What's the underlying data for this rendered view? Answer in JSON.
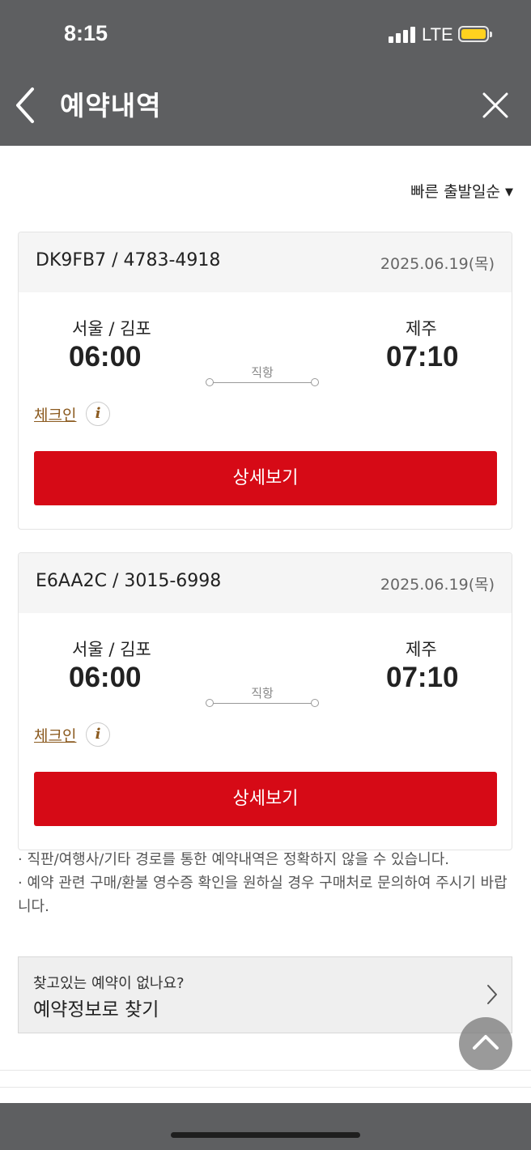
{
  "status_bar": {
    "time": "8:15",
    "network": "LTE",
    "icons": [
      "signal-icon",
      "battery-icon"
    ]
  },
  "header": {
    "title": "예약내역",
    "back_icon": "chevron-left-icon",
    "close_icon": "close-icon"
  },
  "sort": {
    "label": "빠른 출발일순",
    "caret": "▼"
  },
  "reservations": [
    {
      "code": "DK9FB7 / 4783-4918",
      "date": "2025.06.19(목)",
      "departure_city": "서울 / 김포",
      "departure_time": "06:00",
      "arrival_city": "제주",
      "arrival_time": "07:10",
      "route_type": "직항",
      "checkin_label": "체크인",
      "info_glyph": "i",
      "detail_label": "상세보기"
    },
    {
      "code": "E6AA2C / 3015-6998",
      "date": "2025.06.19(목)",
      "departure_city": "서울 / 김포",
      "departure_time": "06:00",
      "arrival_city": "제주",
      "arrival_time": "07:10",
      "route_type": "직항",
      "checkin_label": "체크인",
      "info_glyph": "i",
      "detail_label": "상세보기"
    }
  ],
  "notices": [
    "· 직판/여행사/기타 경로를 통한 예약내역은 정확하지 않을 수 있습니다.",
    "· 예약 관련 구매/환불 영수증 확인을 원하실 경우 구매처로 문의하여 주시기 바랍니다."
  ],
  "find": {
    "question": "찾고있는 예약이 없나요?",
    "link": "예약정보로 찾기"
  },
  "colors": {
    "header_bg": "#5e5f61",
    "primary_button": "#d60a16",
    "checkin_text": "#8b5a1f",
    "battery": "#ffd21f"
  }
}
